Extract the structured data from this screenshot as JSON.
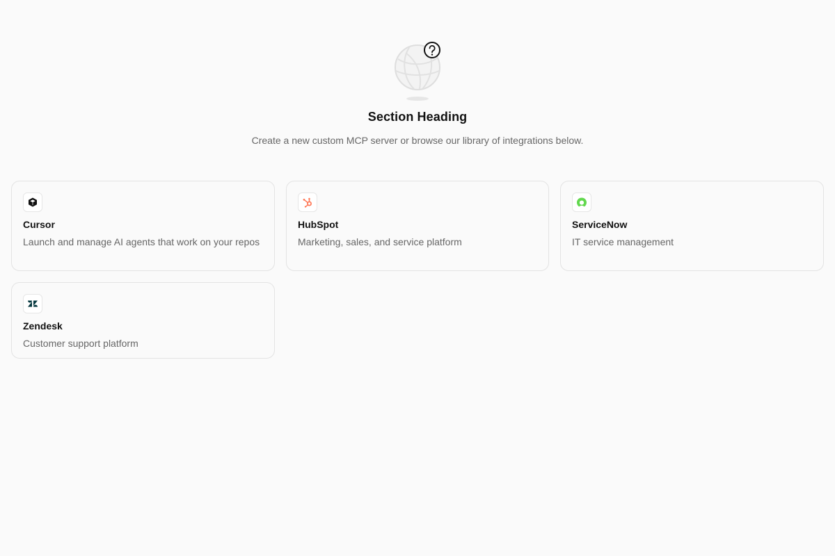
{
  "hero": {
    "heading": "Section Heading",
    "subheading": "Create a new custom MCP server or browse our library of integrations below.",
    "illustration_icon": "globe-question-icon"
  },
  "integrations": [
    {
      "name": "Cursor",
      "description": "Launch and manage AI agents that work on your repos",
      "icon": "cursor-cube-icon",
      "color": "#111111"
    },
    {
      "name": "HubSpot",
      "description": "Marketing, sales, and service platform",
      "icon": "hubspot-sprocket-icon",
      "color": "#ff7a59"
    },
    {
      "name": "ServiceNow",
      "description": "IT service management",
      "icon": "servicenow-ring-icon",
      "color": "#62d84e"
    },
    {
      "name": "Zendesk",
      "description": "Customer support platform",
      "icon": "zendesk-z-icon",
      "color": "#03363d"
    }
  ]
}
